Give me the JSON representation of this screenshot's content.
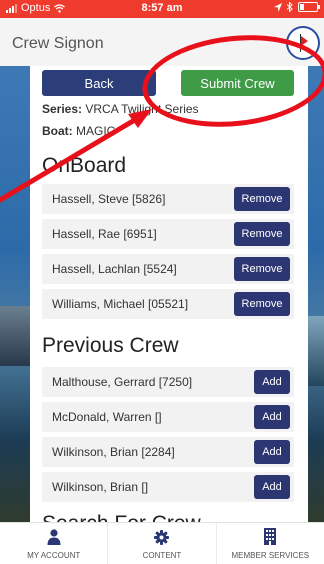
{
  "status_bar": {
    "carrier": "Optus",
    "time": "8:57 am"
  },
  "header": {
    "title": "Crew Signon"
  },
  "actions": {
    "back_label": "Back",
    "submit_label": "Submit Crew"
  },
  "info": {
    "series_label": "Series:",
    "series_value": "VRCA Twilight Series",
    "boat_label": "Boat:",
    "boat_value": "MAGIC"
  },
  "onboard": {
    "title": "OnBoard",
    "action_label": "Remove",
    "members": [
      {
        "name": "Hassell, Steve [5826]"
      },
      {
        "name": "Hassell, Rae [6951]"
      },
      {
        "name": "Hassell, Lachlan [5524]"
      },
      {
        "name": "Williams, Michael [05521]"
      }
    ]
  },
  "previous_crew": {
    "title": "Previous Crew",
    "action_label": "Add",
    "members": [
      {
        "name": "Malthouse, Gerrard [7250]"
      },
      {
        "name": "McDonald, Warren []"
      },
      {
        "name": "Wilkinson, Brian [2284]"
      },
      {
        "name": "Wilkinson, Brian []"
      }
    ]
  },
  "search": {
    "title": "Search For Crew"
  },
  "tabs": [
    {
      "label": "MY ACCOUNT",
      "icon": "person-icon"
    },
    {
      "label": "CONTENT",
      "icon": "gear-icon"
    },
    {
      "label": "MEMBER SERVICES",
      "icon": "building-icon"
    }
  ],
  "colors": {
    "status_bar": "#ef3b2d",
    "primary_button": "#2c3e7a",
    "submit_button": "#3f9b45",
    "row_action": "#2c3673",
    "annotation": "#e8101a"
  }
}
